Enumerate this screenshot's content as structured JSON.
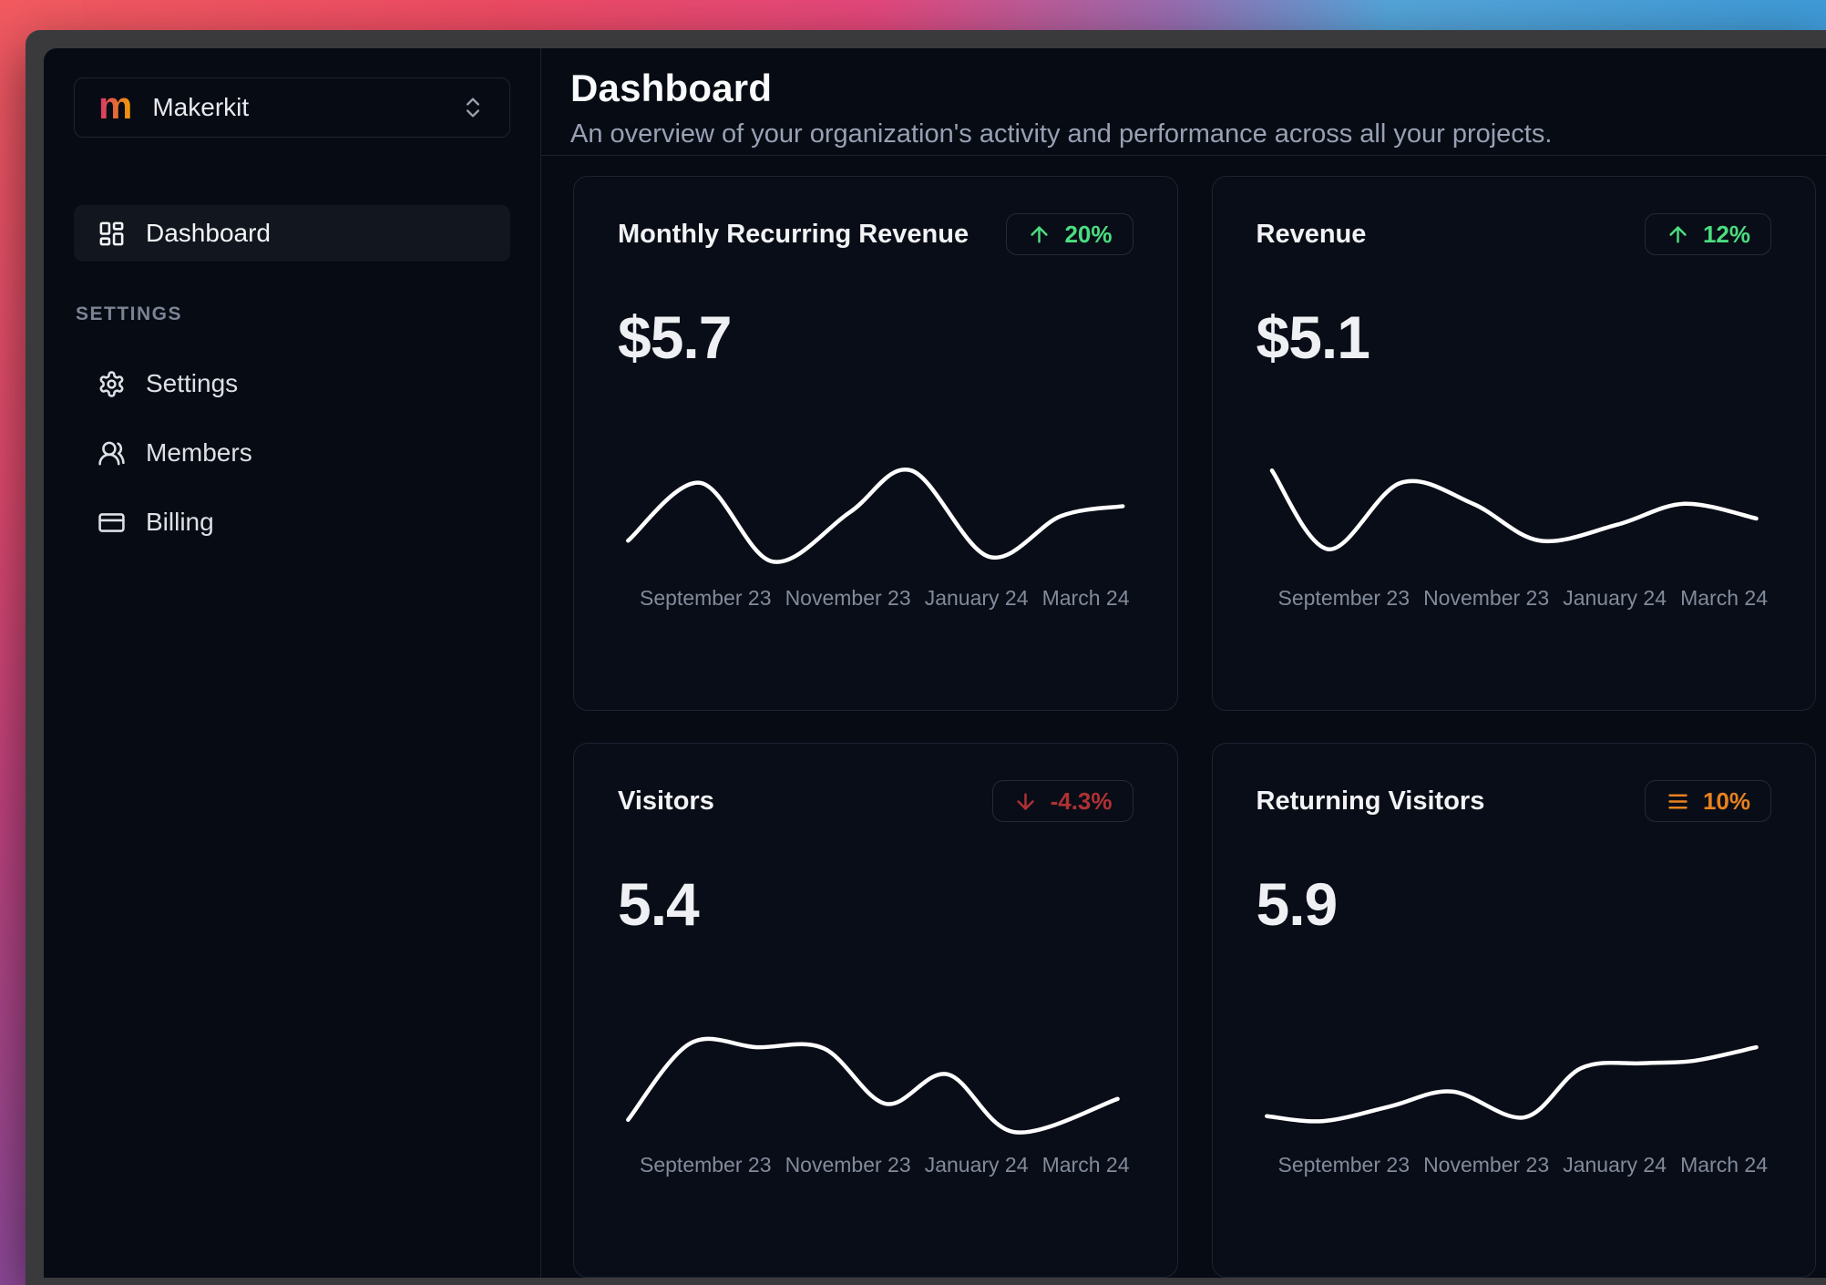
{
  "colors": {
    "brand_from": "#d6336c",
    "brand_to": "#f59f00",
    "positive": "#4ade80",
    "negative": "#ae3134",
    "warning": "#e8821f",
    "chart_line": "#ffffff"
  },
  "sidebar": {
    "workspace": {
      "logo_letter": "m",
      "name": "Makerkit",
      "selector_icon": "chevrons-up-down"
    },
    "nav_main": [
      {
        "label": "Dashboard",
        "icon": "layout-dashboard",
        "active": true
      }
    ],
    "section_label": "SETTINGS",
    "nav_settings": [
      {
        "label": "Settings",
        "icon": "gear"
      },
      {
        "label": "Members",
        "icon": "users"
      },
      {
        "label": "Billing",
        "icon": "credit-card"
      }
    ]
  },
  "header": {
    "title": "Dashboard",
    "subtitle": "An overview of your organization's activity and performance across all your projects."
  },
  "chart_data": [
    {
      "type": "line",
      "title": "Monthly Recurring Revenue",
      "value": "$5.7",
      "trend": {
        "direction": "up",
        "label": "20%",
        "icon": "arrow-up",
        "color": "#4ade80"
      },
      "x_labels": [
        "September 23",
        "November 23",
        "January 24",
        "March 24"
      ],
      "ylim": [
        0,
        100
      ],
      "grid": false,
      "points": [
        [
          2,
          25
        ],
        [
          16,
          72
        ],
        [
          30,
          8
        ],
        [
          45,
          48
        ],
        [
          57,
          82
        ],
        [
          72,
          12
        ],
        [
          86,
          45
        ],
        [
          98,
          53
        ]
      ]
    },
    {
      "type": "line",
      "title": "Revenue",
      "value": "$5.1",
      "trend": {
        "direction": "up",
        "label": "12%",
        "icon": "arrow-up",
        "color": "#4ade80"
      },
      "x_labels": [
        "September 23",
        "November 23",
        "January 24",
        "March 24"
      ],
      "ylim": [
        0,
        100
      ],
      "grid": false,
      "points": [
        [
          3,
          82
        ],
        [
          14,
          18
        ],
        [
          28,
          72
        ],
        [
          42,
          55
        ],
        [
          55,
          25
        ],
        [
          70,
          38
        ],
        [
          83,
          55
        ],
        [
          97,
          43
        ]
      ]
    },
    {
      "type": "line",
      "title": "Visitors",
      "value": "5.4",
      "trend": {
        "direction": "down",
        "label": "-4.3%",
        "icon": "arrow-down",
        "color": "#ae3134"
      },
      "x_labels": [
        "September 23",
        "November 23",
        "January 24",
        "March 24"
      ],
      "ylim": [
        0,
        100
      ],
      "grid": false,
      "points": [
        [
          2,
          15
        ],
        [
          14,
          77
        ],
        [
          27,
          74
        ],
        [
          40,
          73
        ],
        [
          52,
          28
        ],
        [
          64,
          52
        ],
        [
          77,
          5
        ],
        [
          97,
          32
        ]
      ]
    },
    {
      "type": "line",
      "title": "Returning Visitors",
      "value": "5.9",
      "trend": {
        "direction": "flat",
        "label": "10%",
        "icon": "menu",
        "color": "#e8821f"
      },
      "x_labels": [
        "September 23",
        "November 23",
        "January 24",
        "March 24"
      ],
      "ylim": [
        0,
        100
      ],
      "grid": false,
      "points": [
        [
          2,
          18
        ],
        [
          13,
          14
        ],
        [
          26,
          26
        ],
        [
          38,
          38
        ],
        [
          52,
          17
        ],
        [
          63,
          57
        ],
        [
          75,
          61
        ],
        [
          85,
          63
        ],
        [
          97,
          74
        ]
      ]
    }
  ]
}
